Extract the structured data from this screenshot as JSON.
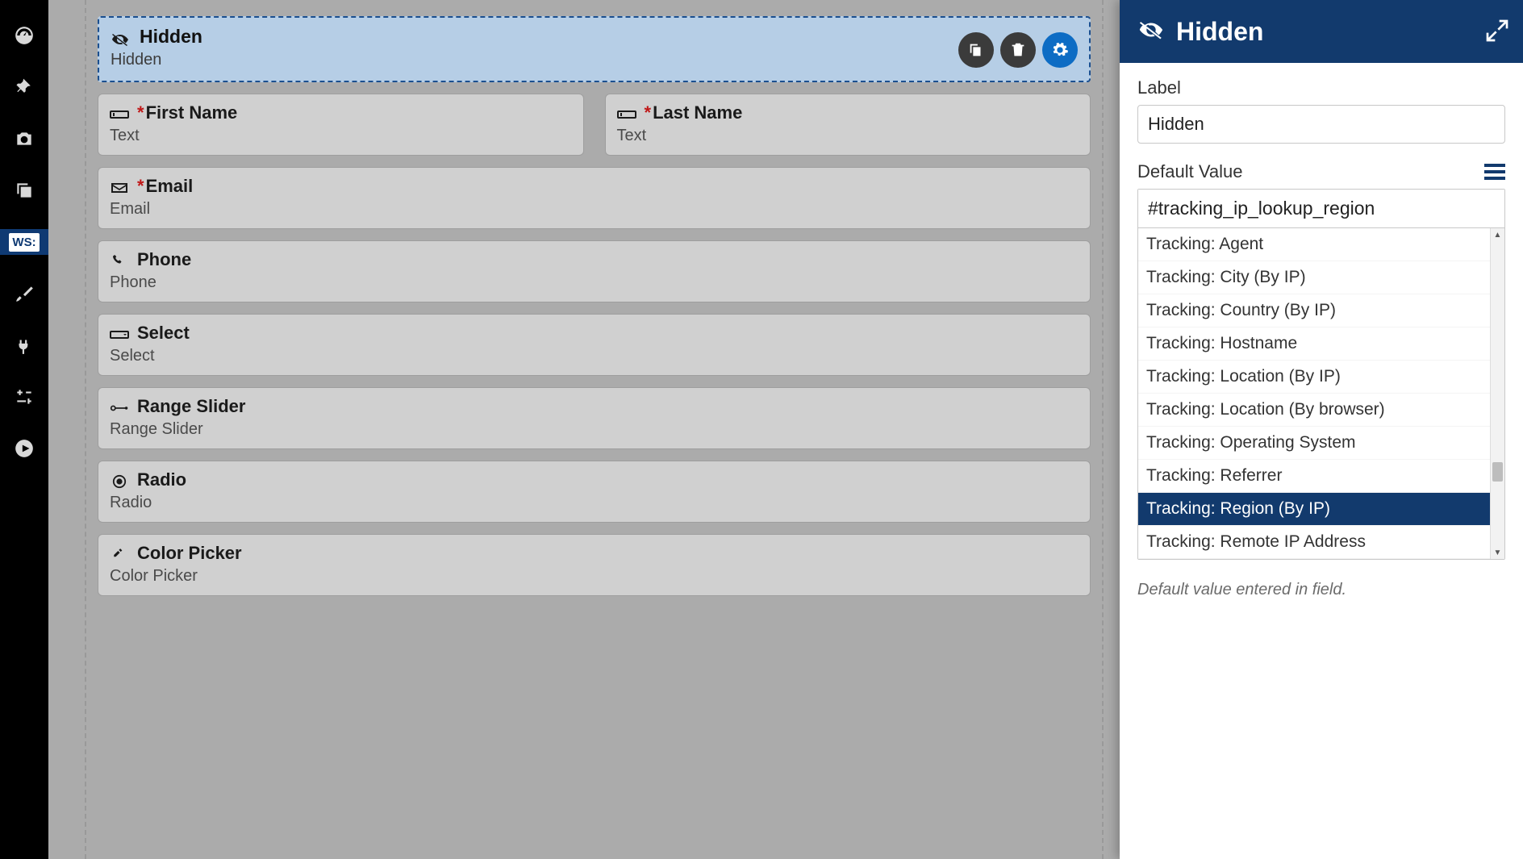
{
  "panel": {
    "title": "Hidden",
    "label_label": "Label",
    "label_value": "Hidden",
    "default_label": "Default Value",
    "default_search": "#tracking_ip_lookup_region",
    "hint": "Default value entered in field.",
    "options": [
      "Tracking: Agent",
      "Tracking: City (By IP)",
      "Tracking: Country (By IP)",
      "Tracking: Hostname",
      "Tracking: Location (By IP)",
      "Tracking: Location (By browser)",
      "Tracking: Operating System",
      "Tracking: Referrer",
      "Tracking: Region (By IP)",
      "Tracking: Remote IP Address"
    ],
    "selected_index": 8
  },
  "selected_field": {
    "title": "Hidden",
    "sub": "Hidden"
  },
  "fields": {
    "first_name": {
      "label": "First Name",
      "sub": "Text",
      "required": true
    },
    "last_name": {
      "label": "Last Name",
      "sub": "Text",
      "required": true
    },
    "email": {
      "label": "Email",
      "sub": "Email",
      "required": true
    },
    "phone": {
      "label": "Phone",
      "sub": "Phone"
    },
    "select": {
      "label": "Select",
      "sub": "Select"
    },
    "range": {
      "label": "Range Slider",
      "sub": "Range Slider"
    },
    "radio": {
      "label": "Radio",
      "sub": "Radio"
    },
    "color": {
      "label": "Color Picker",
      "sub": "Color Picker"
    }
  },
  "rail_active": "WS:"
}
